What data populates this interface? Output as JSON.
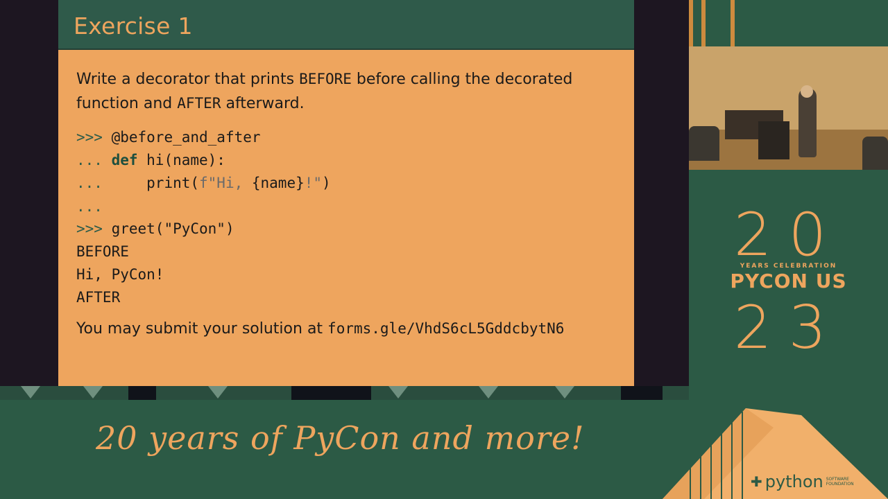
{
  "slide": {
    "title": "Exercise 1",
    "intro": {
      "p1": "Write a decorator that prints ",
      "before_word": "BEFORE",
      "p2": " before calling the decorated function and ",
      "after_word": "AFTER",
      "p3": " afterward."
    },
    "code": {
      "l1_prompt": ">>>",
      "l1_code": " @before_and_after",
      "l2_prompt": "...",
      "l2_kw": " def",
      "l2_code": " hi(name):",
      "l3_prompt": "...",
      "l3_code": "     print(",
      "l3_str": "f\"Hi, ",
      "l3_code2": "{name}",
      "l3_str2": "!\"",
      "l3_code3": ")",
      "l4_prompt": "...",
      "l5_prompt": ">>>",
      "l5_code": " greet(\"PyCon\")",
      "l6_out": "BEFORE",
      "l7_out": "Hi, PyCon!",
      "l8_out": "AFTER"
    },
    "submit": {
      "text": "You may submit your solution at ",
      "url": "forms.gle/VhdS6cL5GddcbytN6"
    }
  },
  "logo": {
    "top_digits": "20",
    "years_text": "YEARS CELEBRATION",
    "name": "PYCON US",
    "bottom_digits": "23"
  },
  "banner": {
    "tagline": "20 years of PyCon and more!",
    "python_word": "python",
    "python_sub": "SOFTWARE FOUNDATION"
  },
  "colors": {
    "accent": "#eea55e",
    "brand_green": "#2c5a45",
    "slide_frame": "#1d1621"
  }
}
